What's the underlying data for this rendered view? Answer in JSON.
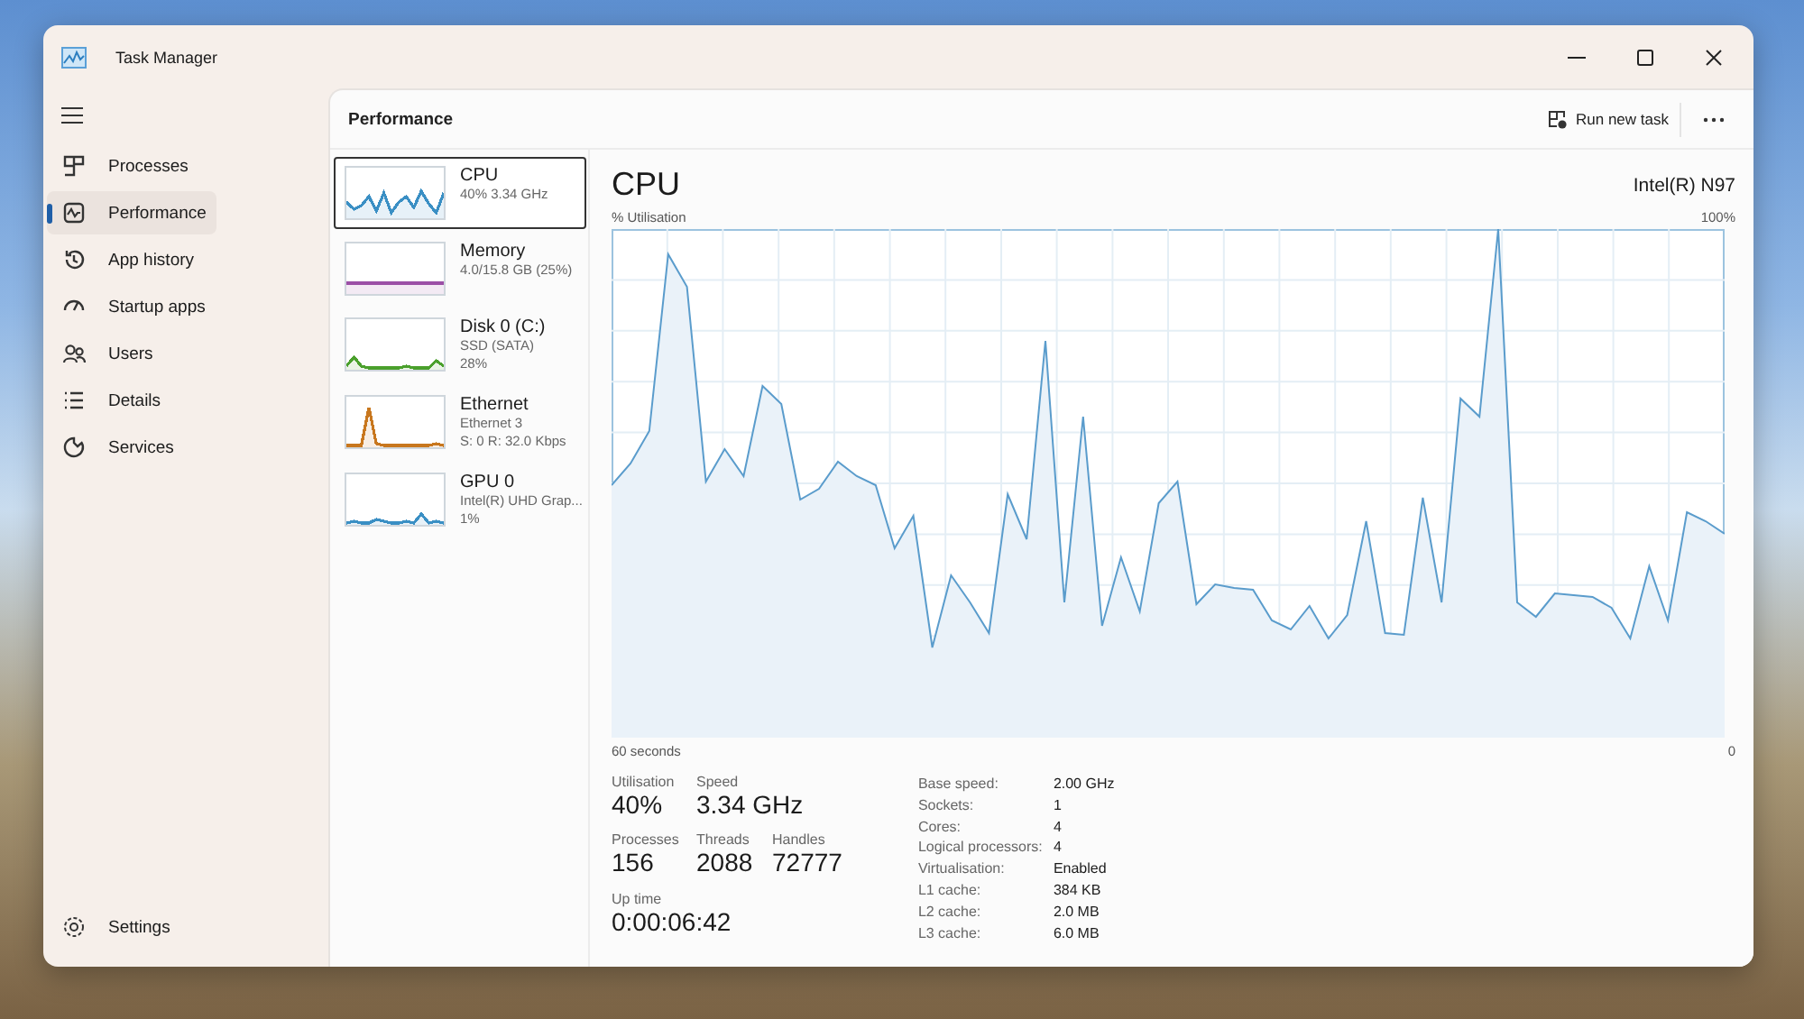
{
  "window": {
    "title": "Task Manager"
  },
  "sidebar": {
    "items": [
      {
        "label": "Processes",
        "selected": false
      },
      {
        "label": "Performance",
        "selected": true
      },
      {
        "label": "App history",
        "selected": false
      },
      {
        "label": "Startup apps",
        "selected": false
      },
      {
        "label": "Users",
        "selected": false
      },
      {
        "label": "Details",
        "selected": false
      },
      {
        "label": "Services",
        "selected": false
      }
    ],
    "footer": {
      "label": "Settings"
    }
  },
  "header": {
    "title": "Performance",
    "action": "Run new task"
  },
  "devices": [
    {
      "name": "CPU",
      "details": [
        "40%  3.34 GHz"
      ],
      "color": "#3a8fc4",
      "selected": true
    },
    {
      "name": "Memory",
      "details": [
        "4.0/15.8 GB (25%)"
      ],
      "color": "#9b4fa6",
      "selected": false
    },
    {
      "name": "Disk 0 (C:)",
      "details": [
        "SSD (SATA)",
        "28%"
      ],
      "color": "#4aa02c",
      "selected": false
    },
    {
      "name": "Ethernet",
      "details": [
        "Ethernet 3",
        "S: 0 R: 32.0 Kbps"
      ],
      "color": "#c8771e",
      "selected": false
    },
    {
      "name": "GPU 0",
      "details": [
        "Intel(R) UHD Grap...",
        "1%"
      ],
      "color": "#3a8fc4",
      "selected": false
    }
  ],
  "cpu": {
    "title": "CPU",
    "model": "Intel(R) N97",
    "graph_label": "% Utilisation",
    "graph_max": "100%",
    "graph_span": "60 seconds",
    "graph_end": "0",
    "stats": [
      {
        "label": "Utilisation",
        "value": "40%"
      },
      {
        "label": "Speed",
        "value": "3.34 GHz"
      },
      {
        "label": "Processes",
        "value": "156"
      },
      {
        "label": "Threads",
        "value": "2088"
      },
      {
        "label": "Handles",
        "value": "72777"
      },
      {
        "label": "Up time",
        "value": "0:00:06:42"
      }
    ],
    "specs": [
      {
        "label": "Base speed:",
        "value": "2.00 GHz"
      },
      {
        "label": "Sockets:",
        "value": "1"
      },
      {
        "label": "Cores:",
        "value": "4"
      },
      {
        "label": "Logical processors:",
        "value": "4"
      },
      {
        "label": "Virtualisation:",
        "value": "Enabled"
      },
      {
        "label": "L1 cache:",
        "value": "384 KB"
      },
      {
        "label": "L2 cache:",
        "value": "2.0 MB"
      },
      {
        "label": "L3 cache:",
        "value": "6.0 MB"
      }
    ]
  }
}
